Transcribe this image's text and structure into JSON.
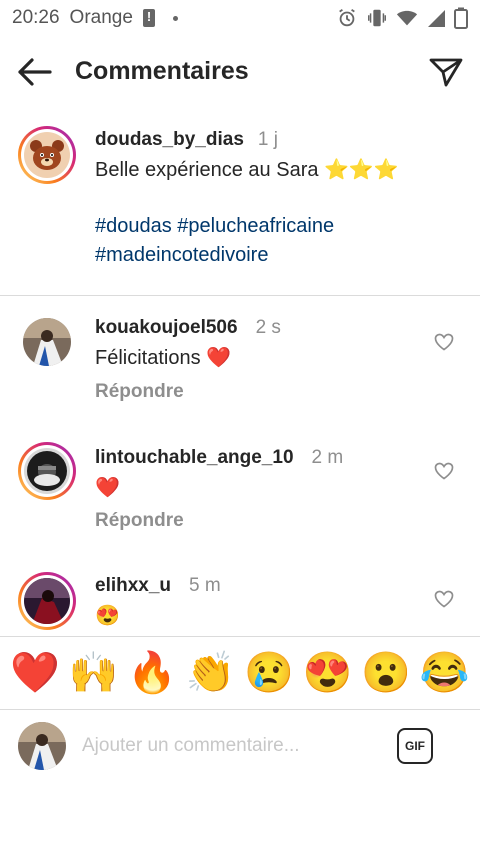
{
  "status_bar": {
    "time": "20:26",
    "carrier": "Orange"
  },
  "header": {
    "title": "Commentaires"
  },
  "caption": {
    "username": "doudas_by_dias",
    "time": "1 j",
    "text": "Belle expérience au Sara ⭐⭐⭐",
    "hashtags_line1": "#doudas #pelucheafricaine",
    "hashtags_line2": "#madeincotedivoire"
  },
  "comments": [
    {
      "username": "kouakoujoel506",
      "time": "2 s",
      "text": "Félicitations ❤️",
      "reply_label": "Répondre"
    },
    {
      "username": "lintouchable_ange_10",
      "time": "2 m",
      "text": "❤️",
      "reply_label": "Répondre"
    },
    {
      "username": "elihxx_u",
      "time": "5 m",
      "text": "😍"
    }
  ],
  "emoji_bar": [
    "❤️",
    "🙌",
    "🔥",
    "👏",
    "😢",
    "😍",
    "😮",
    "😂"
  ],
  "composer": {
    "placeholder": "Ajouter un commentaire...",
    "gif_label": "GIF"
  },
  "icons": {
    "back": "arrow-left-icon",
    "send": "paper-plane-icon",
    "like": "heart-outline-icon"
  },
  "colors": {
    "hashtag": "#00376b",
    "muted": "#8e8e8e",
    "text": "#262626"
  }
}
